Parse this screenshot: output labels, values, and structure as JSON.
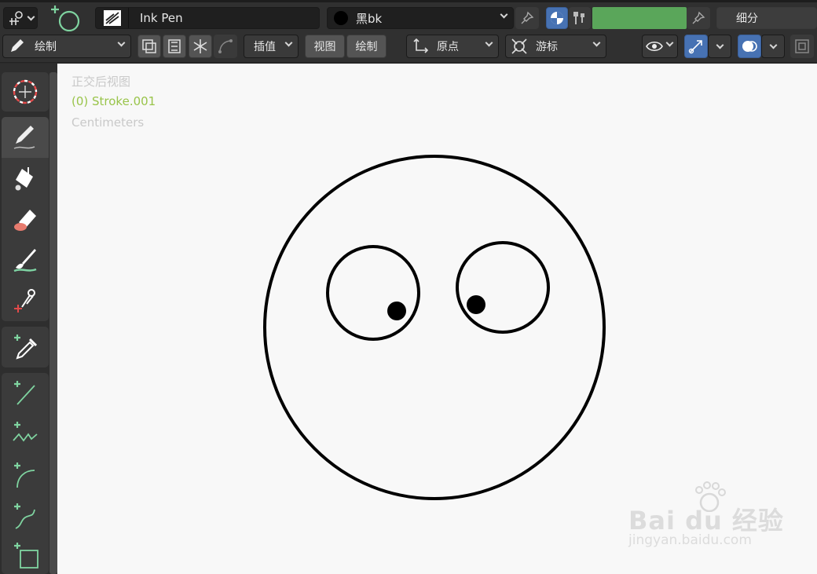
{
  "header": {
    "brush_name": "Ink Pen",
    "material_name": "黑bk",
    "subdivide_label": "细分"
  },
  "toolbar2": {
    "mode_label": "绘制",
    "interpolate_label": "插值",
    "view_label": "视图",
    "draw_label": "绘制",
    "origin_label": "原点",
    "cursor_label": "游标"
  },
  "viewport": {
    "view_name": "正交后视图",
    "object_name": "(0) Stroke.001",
    "units": "Centimeters"
  },
  "watermark": {
    "brand": "Bai du 经验",
    "url": "jingyan.baidu.com"
  },
  "colors": {
    "active_color": "#5aa65a",
    "accent": "#4772b3",
    "stroke": "#000000"
  }
}
